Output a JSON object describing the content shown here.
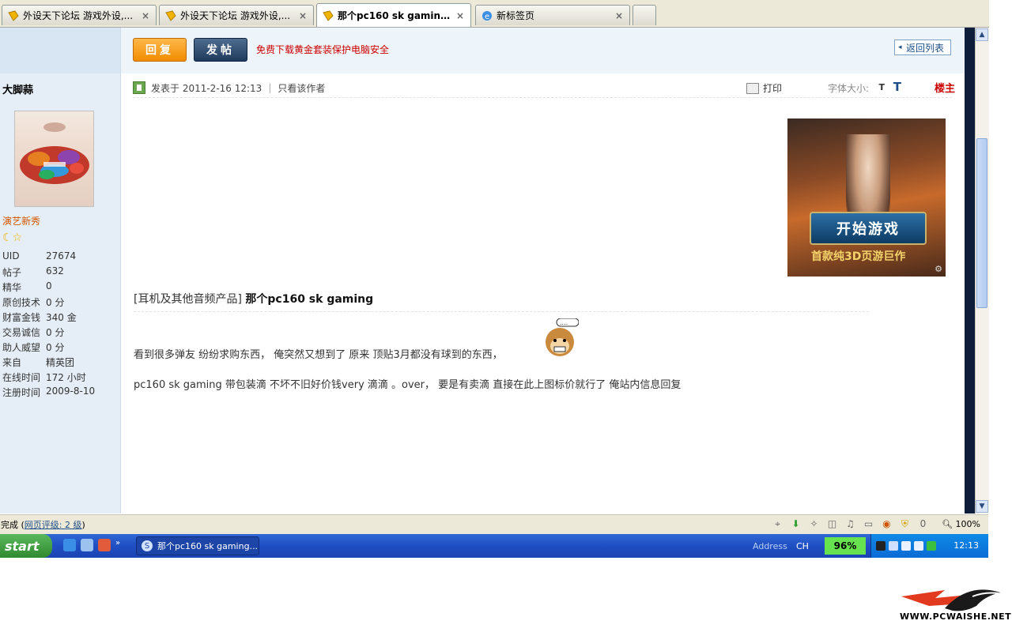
{
  "tabs": [
    {
      "title": "外设天下论坛 游戏外设,...",
      "active": false
    },
    {
      "title": "外设天下论坛 游戏外设,...",
      "active": false
    },
    {
      "title": "那个pc160 sk gaming - ...",
      "active": true
    },
    {
      "title": "新标签页",
      "active": false
    }
  ],
  "toolbar": {
    "reply_label": "回复",
    "post_label": "发帖",
    "promo": "免费下载黄金套装保护电脑安全",
    "back_list": "返回列表"
  },
  "author": {
    "name": "大脚蒜",
    "rank": "演艺新秀",
    "stats": [
      {
        "k": "UID",
        "v": "27674"
      },
      {
        "k": "帖子",
        "v": "632"
      },
      {
        "k": "精华",
        "v": "0"
      },
      {
        "k": "原创技术",
        "v": "0 分"
      },
      {
        "k": "财富金钱",
        "v": "340 金"
      },
      {
        "k": "交易诚信",
        "v": "0 分"
      },
      {
        "k": "助人威望",
        "v": "0 分"
      },
      {
        "k": "来自",
        "v": "精英团"
      },
      {
        "k": "在线时间",
        "v": "172 小时"
      },
      {
        "k": "注册时间",
        "v": "2009-8-10"
      }
    ]
  },
  "post": {
    "posted_at": "发表于  2011-2-16 12:13",
    "only_author": "只看该作者",
    "print": "打印",
    "font_size_label": "字体大小:",
    "font_small": "T",
    "font_large": "T",
    "floor": "楼主",
    "category": "[耳机及其他音频产品]",
    "title": "那个pc160 sk gaming",
    "line1": "看到很多弹友  纷纷求购东西，  俺突然又想到了  原来  顶贴3月都没有球到的东西，",
    "line2": "pc160 sk gaming  带包装滴  不坏不旧好价钱very 滴滴    。over，  要是有卖滴  直接在此上图标价就行了  俺站内信息回复"
  },
  "ad": {
    "button": "开始游戏",
    "tagline": "首款纯3D页游巨作"
  },
  "statusbar": {
    "text": "完成 (",
    "rating": "网页评级: 2 级",
    "close": ")",
    "count": "0",
    "zoom": "100%"
  },
  "taskbar": {
    "start": "start",
    "task_title": "那个pc160 sk gaming...",
    "address": "Address",
    "lang": "CH",
    "battery": "96%",
    "clock": "12:13"
  },
  "watermark": "WWW.PCWAISHE.NET"
}
